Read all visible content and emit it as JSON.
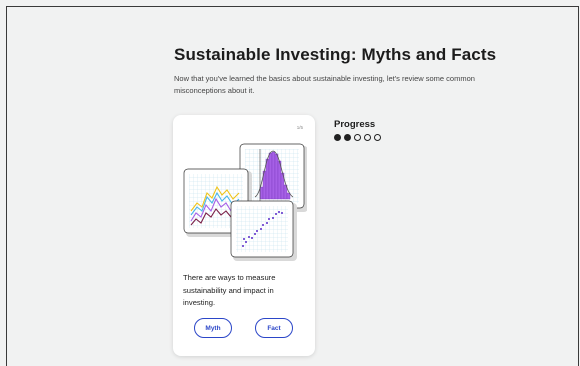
{
  "lesson": {
    "title": "Sustainable Investing: Myths and Facts",
    "intro": "Now that you've learned the basics about sustainable investing, let's review some common misconceptions about it."
  },
  "card": {
    "page_indicator": "1/5",
    "statement": "There are ways to measure sustainability and impact in investing.",
    "illustration": "charts-illustration",
    "myth_label": "Myth",
    "fact_label": "Fact"
  },
  "progress": {
    "label": "Progress",
    "completed": 2,
    "total": 5
  },
  "colors": {
    "accent": "#2b46c8",
    "background": "#f1f2f2",
    "chart_purple": "#a660e6"
  }
}
